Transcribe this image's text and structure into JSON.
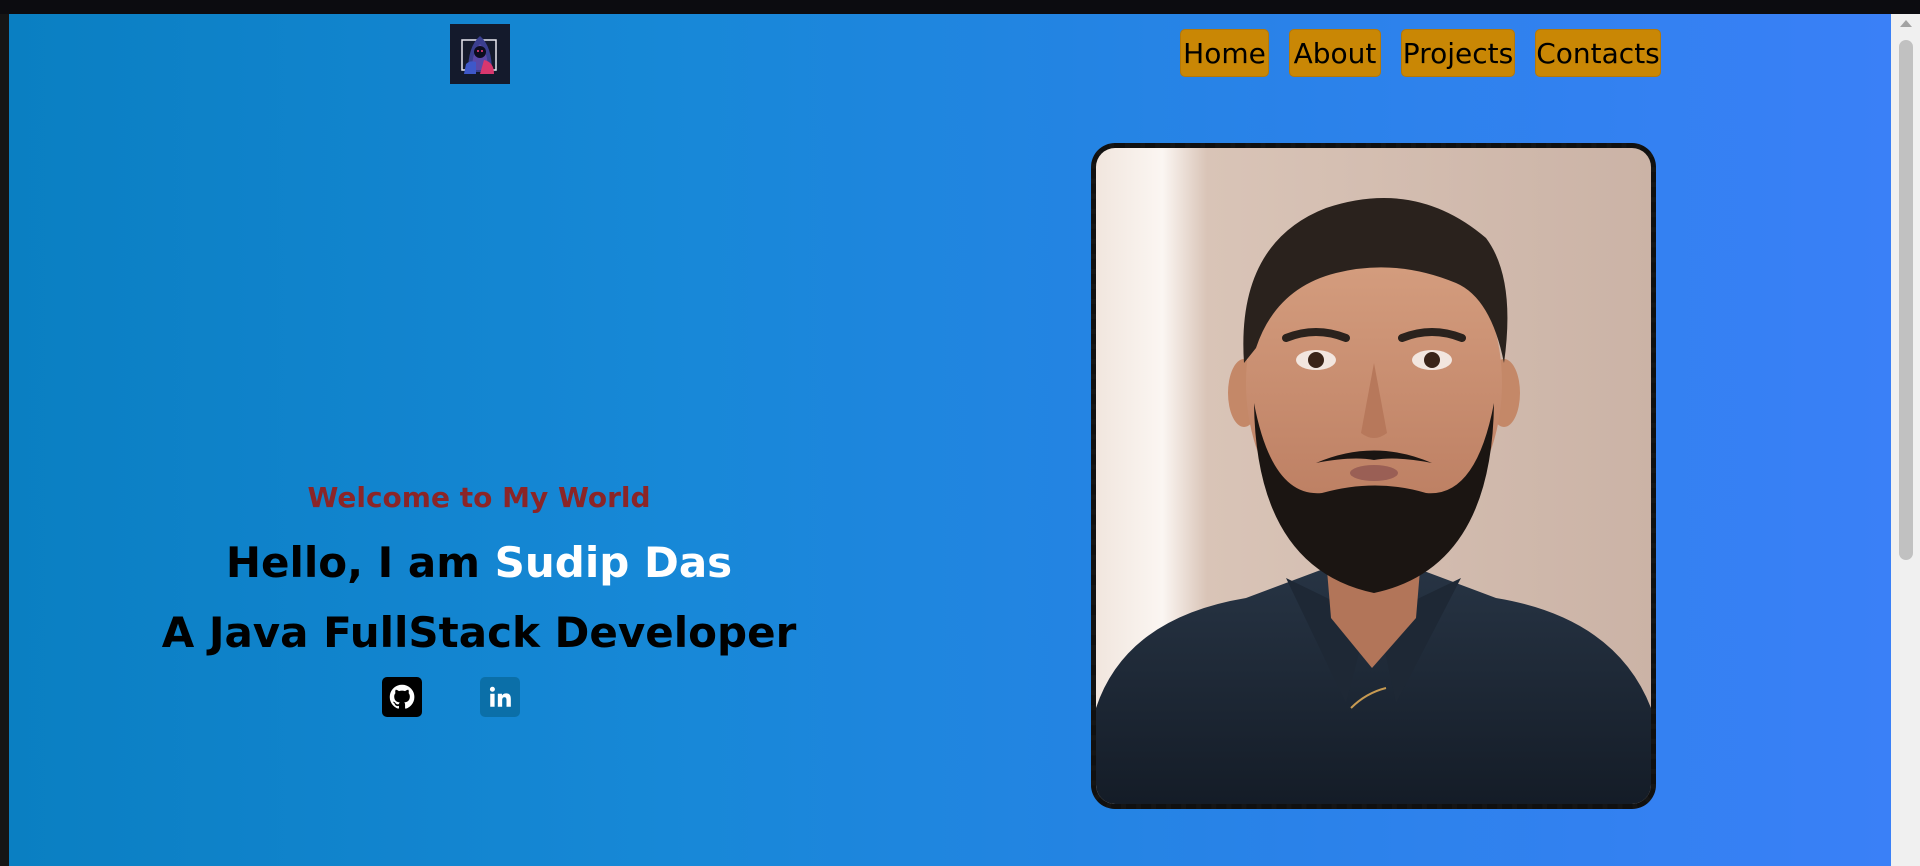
{
  "header": {
    "logo_icon": "hooded-hacker-logo-icon",
    "nav": [
      {
        "label": "Home"
      },
      {
        "label": "About"
      },
      {
        "label": "Projects"
      },
      {
        "label": "Contacts"
      }
    ]
  },
  "hero": {
    "welcome": "Welcome to My World",
    "greeting_prefix": "Hello, I am",
    "name": "Sudip Das",
    "role": "A Java FullStack Developer",
    "social": [
      {
        "icon": "github-icon"
      },
      {
        "icon": "linkedin-icon"
      }
    ]
  },
  "profile_photo": {
    "icon": "profile-photo"
  },
  "colors": {
    "background_left": "#0a7fc2",
    "background_right": "#3a80f7",
    "nav_button": "#c98705",
    "welcome_text": "#8b2527",
    "name_text": "#ffffff"
  }
}
